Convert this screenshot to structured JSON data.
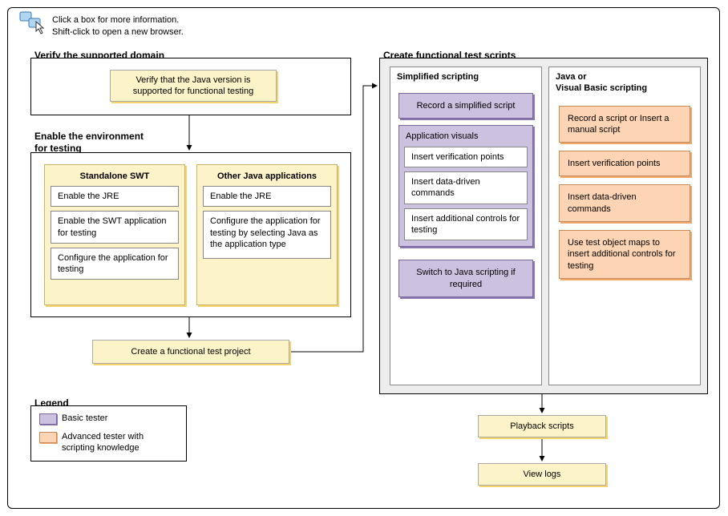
{
  "hint": {
    "line1": "Click a box for more information.",
    "line2": "Shift-click to open a new browser."
  },
  "sections": {
    "verify": {
      "title": "Verify the supported domain",
      "box": "Verify that the Java version is supported for functional testing"
    },
    "enable": {
      "title": "Enable the environment for testing",
      "standalone": {
        "title": "Standalone SWT",
        "items": [
          "Enable the JRE",
          "Enable the SWT application for testing",
          "Configure the application for testing"
        ]
      },
      "other": {
        "title": "Other Java applications",
        "items": [
          "Enable the JRE",
          "Configure the application for testing by selecting Java as the application type"
        ]
      }
    },
    "create_project": "Create a functional test project",
    "functional": {
      "title": "Create functional test scripts",
      "simplified": {
        "title": "Simplified scripting",
        "record": "Record a simplified script",
        "visuals_title": "Application visuals",
        "visuals": [
          "Insert verification points",
          "Insert data-driven commands",
          "Insert additional controls for testing"
        ],
        "switch": "Switch to Java scripting if required"
      },
      "java_vb": {
        "title": "Java or\nVisual Basic scripting",
        "items": [
          "Record a script or Insert a manual script",
          "Insert verification points",
          "Insert data-driven commands",
          "Use test object maps to insert additional controls for testing"
        ]
      }
    },
    "playback": "Playback scripts",
    "viewlogs": "View logs"
  },
  "legend": {
    "title": "Legend",
    "basic": "Basic tester",
    "advanced": "Advanced tester with scripting knowledge"
  }
}
